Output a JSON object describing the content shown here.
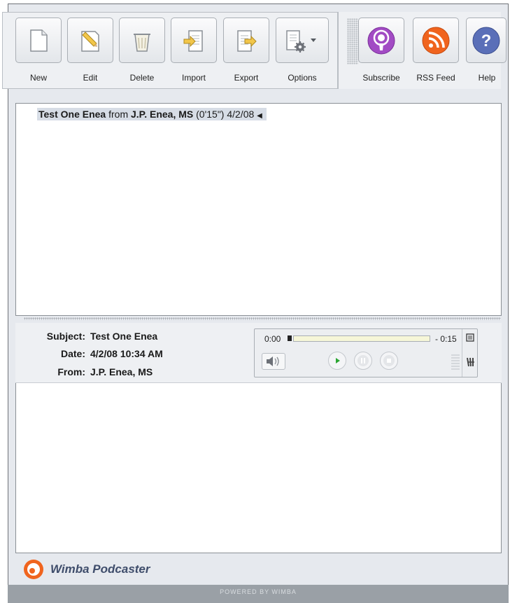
{
  "toolbar": {
    "new_label": "New",
    "edit_label": "Edit",
    "delete_label": "Delete",
    "import_label": "Import",
    "export_label": "Export",
    "options_label": "Options",
    "subscribe_label": "Subscribe",
    "rss_label": "RSS Feed",
    "help_label": "Help"
  },
  "messages": [
    {
      "subject": "Test One Enea",
      "from_word": "from",
      "author": "J.P. Enea, MS",
      "duration": "(0'15\")",
      "date": "4/2/08"
    }
  ],
  "detail": {
    "subject_label": "Subject:",
    "subject": "Test One Enea",
    "date_label": "Date:",
    "date": "4/2/08 10:34 AM",
    "from_label": "From:",
    "from": "J.P. Enea, MS"
  },
  "player": {
    "elapsed": "0:00",
    "remaining": "- 0:15",
    "progress": 0
  },
  "brand": {
    "name": "Wimba Podcaster"
  },
  "footer": {
    "text": "POWERED BY WIMBA"
  },
  "colors": {
    "accent_orange": "#f0641e",
    "subscribe_purple": "#a24bc4",
    "help_blue": "#5a6fb8",
    "play_green": "#2aa532"
  }
}
